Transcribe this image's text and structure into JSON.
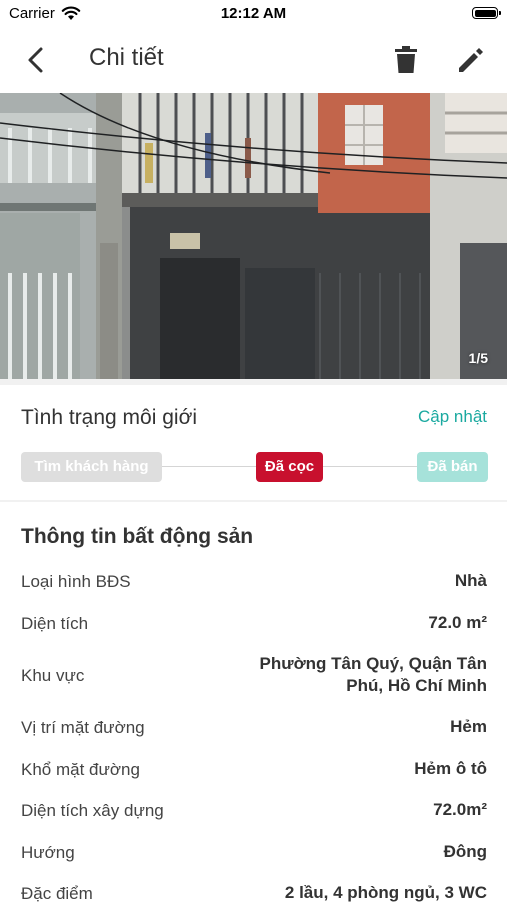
{
  "status_bar": {
    "carrier": "Carrier",
    "time": "12:12 AM"
  },
  "nav": {
    "title": "Chi tiết",
    "icons": [
      "chevron-left-icon",
      "trash-icon",
      "pencil-icon"
    ]
  },
  "photo": {
    "counter": "1/5"
  },
  "brokerage": {
    "title": "Tình trạng môi giới",
    "update_label": "Cập nhật",
    "steps": [
      "Tìm khách hàng",
      "Đã cọc",
      "Đã bán"
    ],
    "active_step": "Đã cọc"
  },
  "property": {
    "title": "Thông tin bất động sản",
    "rows": [
      {
        "label": "Loại hình BĐS",
        "value": "Nhà"
      },
      {
        "label": "Diện tích",
        "value": "72.0 m²"
      },
      {
        "label": "Khu vực",
        "value": "Phường Tân Quý, Quận Tân Phú, Hồ Chí Minh"
      },
      {
        "label": "Vị trí mặt đường",
        "value": "Hẻm"
      },
      {
        "label": "Khổ mặt đường",
        "value": "Hẻm ô tô"
      },
      {
        "label": "Diện tích xây dựng",
        "value": "72.0m²"
      },
      {
        "label": "Hướng",
        "value": "Đông"
      },
      {
        "label": "Đặc điểm",
        "value": "2 lầu, 4 phòng ngủ, 3 WC"
      }
    ]
  },
  "colors": {
    "accent": "#1aa9a0",
    "active_step": "#c8102e",
    "pending_step": "#dedede",
    "future_step": "#a6e2da"
  }
}
